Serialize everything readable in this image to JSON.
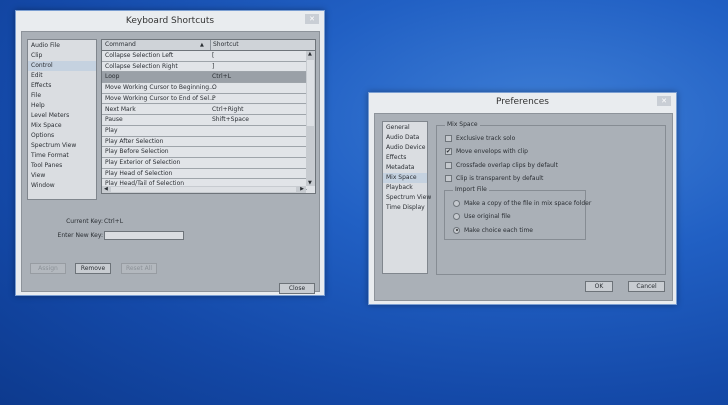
{
  "shortcuts": {
    "title": "Keyboard Shortcuts",
    "categories": [
      "Audio File",
      "Clip",
      "Control",
      "Edit",
      "Effects",
      "File",
      "Help",
      "Level Meters",
      "Mix Space",
      "Options",
      "Spectrum View",
      "Time Format",
      "Tool Panes",
      "View",
      "Window"
    ],
    "selected_category": "Control",
    "columns": {
      "command": "Command",
      "shortcut": "Shortcut"
    },
    "rows": [
      {
        "command": "Collapse Selection Left",
        "shortcut": "["
      },
      {
        "command": "Collapse Selection Right",
        "shortcut": "]"
      },
      {
        "command": "Loop",
        "shortcut": "Ctrl+L"
      },
      {
        "command": "Move Working Cursor to Beginning...",
        "shortcut": "O"
      },
      {
        "command": "Move Working Cursor to End of Sel...",
        "shortcut": "P"
      },
      {
        "command": "Next Mark",
        "shortcut": "Ctrl+Right"
      },
      {
        "command": "Pause",
        "shortcut": "Shift+Space"
      },
      {
        "command": "Play",
        "shortcut": ""
      },
      {
        "command": "Play After Selection",
        "shortcut": ""
      },
      {
        "command": "Play Before Selection",
        "shortcut": ""
      },
      {
        "command": "Play Exterior of Selection",
        "shortcut": ""
      },
      {
        "command": "Play Head of Selection",
        "shortcut": ""
      },
      {
        "command": "Play Head/Tail of Selection",
        "shortcut": ""
      }
    ],
    "current_key_label": "Current Key:",
    "current_key_value": "Ctrl+L",
    "new_key_label": "Enter New Key:",
    "new_key_value": "",
    "assign": "Assign",
    "remove": "Remove",
    "reset_all": "Reset All",
    "close": "Close"
  },
  "preferences": {
    "title": "Preferences",
    "categories": [
      "General",
      "Audio Data",
      "Audio Device",
      "Effects",
      "Metadata",
      "Mix Space",
      "Playback",
      "Spectrum View",
      "Time Display"
    ],
    "selected_category": "Mix Space",
    "group_title": "Mix Space",
    "checkboxes": [
      {
        "label": "Exclusive track solo",
        "checked": false
      },
      {
        "label": "Move envelops with clip",
        "checked": true
      },
      {
        "label": "Crossfade overlap clips by default",
        "checked": false
      },
      {
        "label": "Clip is transparent by default",
        "checked": false
      }
    ],
    "import_group_title": "Import File",
    "radios": [
      {
        "label": "Make a copy of the file in mix space folder",
        "selected": false
      },
      {
        "label": "Use original file",
        "selected": false
      },
      {
        "label": "Make choice each time",
        "selected": true
      }
    ],
    "ok": "OK",
    "cancel": "Cancel"
  }
}
